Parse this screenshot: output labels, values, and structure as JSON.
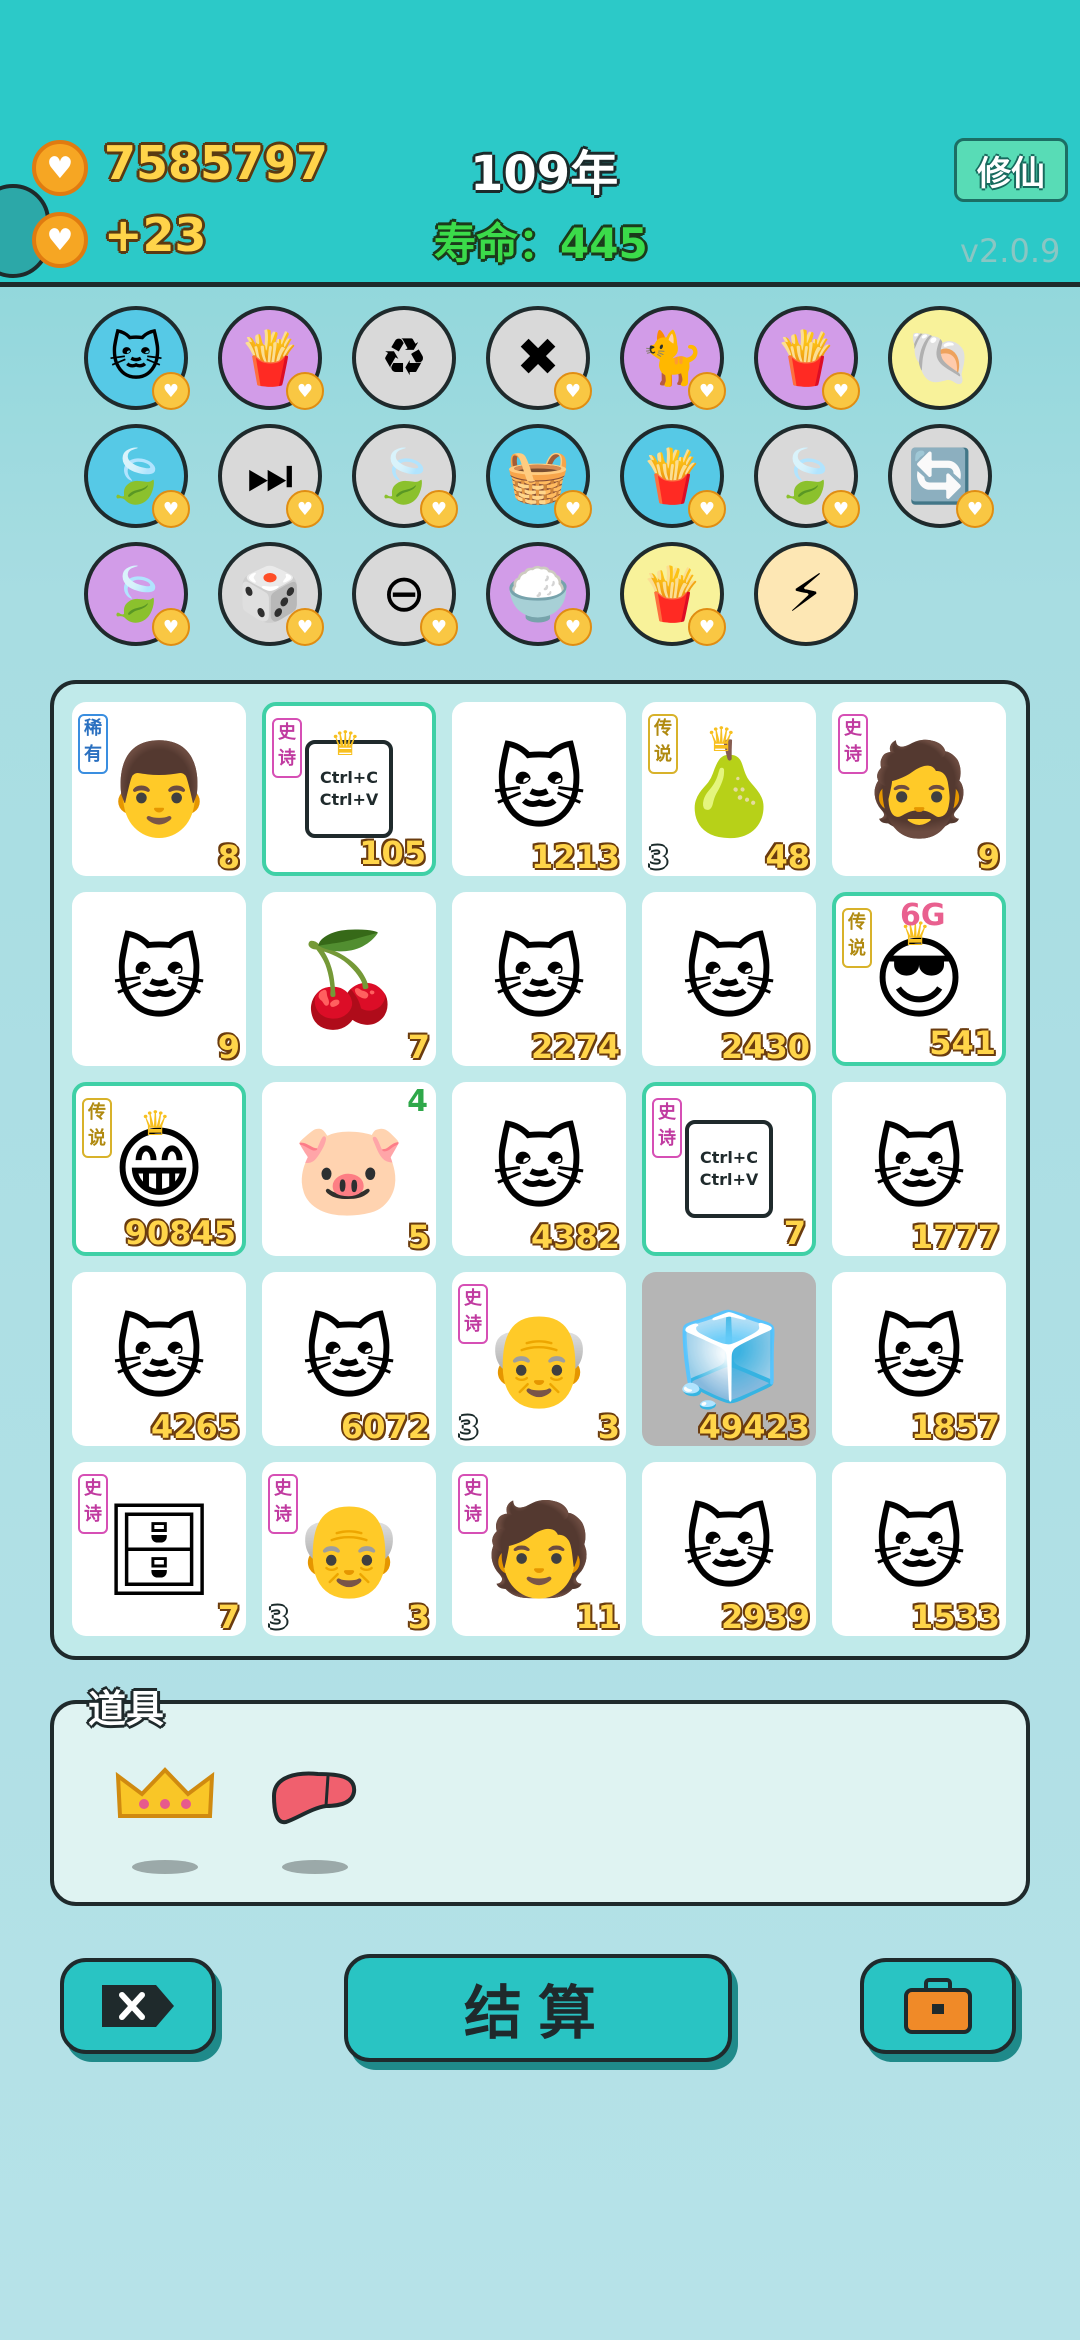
{
  "header": {
    "coins": "7585797",
    "coin_gain": "+23",
    "year": "109年",
    "lifespan": "寿命：445",
    "xiuxian_button": "修仙",
    "version": "v2.0.9"
  },
  "relics": [
    {
      "icon": "cat-icon",
      "bg": "#56c9e6",
      "heart": true
    },
    {
      "icon": "fries-icon",
      "bg": "#d29ce8",
      "heart": true
    },
    {
      "icon": "recycle-icon",
      "bg": "#d9d9d9",
      "heart": false
    },
    {
      "icon": "delete-icon",
      "bg": "#d9d9d9",
      "heart": true
    },
    {
      "icon": "two-cats-icon",
      "bg": "#d29ce8",
      "heart": true
    },
    {
      "icon": "fries-icon",
      "bg": "#d29ce8",
      "heart": true
    },
    {
      "icon": "shell-icon",
      "bg": "#f8f29a",
      "heart": false
    },
    {
      "icon": "leaf-icon",
      "bg": "#56c9e6",
      "heart": true
    },
    {
      "icon": "skip-icon",
      "bg": "#d9d9d9",
      "heart": true
    },
    {
      "icon": "leaf-icon",
      "bg": "#d9d9d9",
      "heart": true
    },
    {
      "icon": "basket-icon",
      "bg": "#56c9e6",
      "heart": true
    },
    {
      "icon": "fries-icon",
      "bg": "#56c9e6",
      "heart": true
    },
    {
      "icon": "leaf-icon",
      "bg": "#d9d9d9",
      "heart": true
    },
    {
      "icon": "refresh-icon",
      "bg": "#d9d9d9",
      "heart": true
    },
    {
      "icon": "leaf-icon",
      "bg": "#d29ce8",
      "heart": true
    },
    {
      "icon": "dice-icon",
      "bg": "#d9d9d9",
      "heart": true
    },
    {
      "icon": "minus-icon",
      "bg": "#d9d9d9",
      "heart": true
    },
    {
      "icon": "rice-bowl-icon",
      "bg": "#d29ce8",
      "heart": true
    },
    {
      "icon": "fries-icon",
      "bg": "#f8f29a",
      "heart": true
    },
    {
      "icon": "lightning-icon",
      "bg": "#fde7b4",
      "heart": false
    }
  ],
  "grid": [
    {
      "icon": "hat-man-icon",
      "count": "8",
      "tag": "稀有",
      "tag_type": "rare"
    },
    {
      "icon": "copy-paste-icon",
      "count": "105",
      "tag": "史诗",
      "tag_type": "epic",
      "highlight": true,
      "crown": true,
      "copy_text": "Ctrl+C\nCtrl+V"
    },
    {
      "icon": "cat-icon",
      "count": "1213"
    },
    {
      "icon": "pear-icon",
      "count": "48",
      "level": "3",
      "tag": "传说",
      "tag_type": "legend",
      "crown": true
    },
    {
      "icon": "bearded-man-icon",
      "count": "9",
      "tag": "史诗",
      "tag_type": "epic"
    },
    {
      "icon": "cat-icon",
      "count": "9"
    },
    {
      "icon": "cherry-icon",
      "count": "7"
    },
    {
      "icon": "cat-icon",
      "count": "2274"
    },
    {
      "icon": "cat-icon",
      "count": "2430"
    },
    {
      "icon": "sunglasses-man-icon",
      "count": "541",
      "tag": "传说",
      "tag_type": "legend",
      "highlight": true,
      "crown": true,
      "top": "6G"
    },
    {
      "icon": "grinning-man-icon",
      "count": "90845",
      "tag": "传说",
      "tag_type": "legend",
      "highlight": true,
      "crown": true
    },
    {
      "icon": "pig-icon",
      "count": "5",
      "top": "4"
    },
    {
      "icon": "cat-icon",
      "count": "4382"
    },
    {
      "icon": "copy-paste-icon",
      "count": "7",
      "tag": "史诗",
      "tag_type": "epic",
      "highlight": true,
      "copy_text": "Ctrl+C\nCtrl+V"
    },
    {
      "icon": "cat-icon",
      "count": "1777"
    },
    {
      "icon": "cat-icon",
      "count": "4265"
    },
    {
      "icon": "cat-icon",
      "count": "6072"
    },
    {
      "icon": "old-man-glasses-icon",
      "count": "3",
      "level": "3",
      "tag": "史诗",
      "tag_type": "epic"
    },
    {
      "icon": "fridge-icon",
      "count": "49423",
      "gray": true
    },
    {
      "icon": "cat-icon",
      "count": "1857"
    },
    {
      "icon": "server-icon",
      "count": "7",
      "tag": "史诗",
      "tag_type": "epic"
    },
    {
      "icon": "old-man-glasses-icon",
      "count": "3",
      "level": "3",
      "tag": "史诗",
      "tag_type": "epic"
    },
    {
      "icon": "green-hat-man-icon",
      "count": "11",
      "tag": "史诗",
      "tag_type": "epic"
    },
    {
      "icon": "cat-icon",
      "count": "2939"
    },
    {
      "icon": "cat-icon",
      "count": "1533"
    }
  ],
  "items": {
    "label": "道具",
    "list": [
      {
        "icon": "crown-icon"
      },
      {
        "icon": "liver-icon"
      }
    ]
  },
  "bottom": {
    "settle_label": "结算",
    "delete_icon": "delete-icon",
    "bag_icon": "briefcase-icon"
  }
}
